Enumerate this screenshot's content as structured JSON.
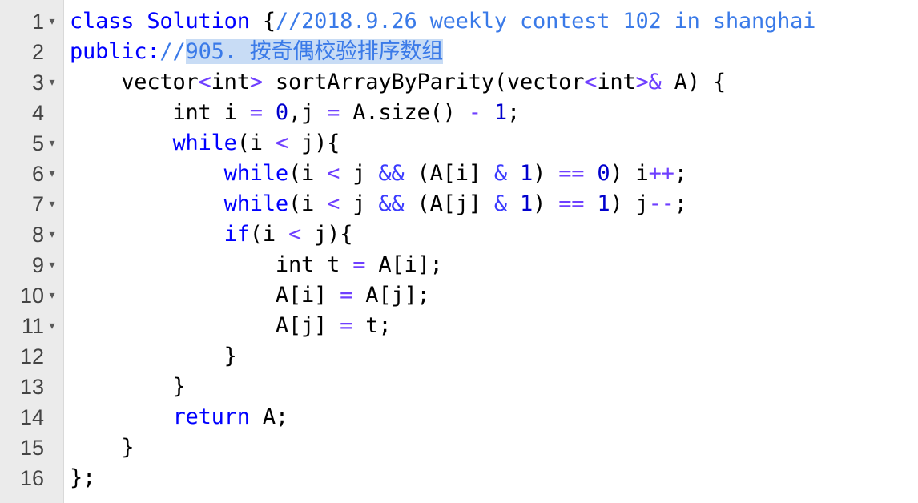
{
  "editor": {
    "lines": [
      {
        "num": "1",
        "fold": "▾",
        "tokens": [
          {
            "t": "class Solution ",
            "c": "kw"
          },
          {
            "t": "{",
            "c": "plain"
          },
          {
            "t": "//2018.9.26 weekly contest 102 in shanghai",
            "c": "cm"
          }
        ]
      },
      {
        "num": "2",
        "fold": "",
        "tokens": [
          {
            "t": "public:",
            "c": "kw"
          },
          {
            "t": "//",
            "c": "cm"
          },
          {
            "t": "905. 按奇偶校验排序数组",
            "c": "cm sel"
          }
        ]
      },
      {
        "num": "3",
        "fold": "▾",
        "tokens": [
          {
            "t": "    vector",
            "c": "plain"
          },
          {
            "t": "<",
            "c": "op"
          },
          {
            "t": "int",
            "c": "plain"
          },
          {
            "t": ">",
            "c": "op"
          },
          {
            "t": " sortArrayByParity(vector",
            "c": "plain"
          },
          {
            "t": "<",
            "c": "op"
          },
          {
            "t": "int",
            "c": "plain"
          },
          {
            "t": ">&",
            "c": "op"
          },
          {
            "t": " A) {",
            "c": "plain"
          }
        ]
      },
      {
        "num": "4",
        "fold": "",
        "tokens": [
          {
            "t": "        int i ",
            "c": "plain"
          },
          {
            "t": "=",
            "c": "op"
          },
          {
            "t": " ",
            "c": "plain"
          },
          {
            "t": "0",
            "c": "num"
          },
          {
            "t": ",j ",
            "c": "plain"
          },
          {
            "t": "=",
            "c": "op"
          },
          {
            "t": " A.size() ",
            "c": "plain"
          },
          {
            "t": "-",
            "c": "op"
          },
          {
            "t": " ",
            "c": "plain"
          },
          {
            "t": "1",
            "c": "num"
          },
          {
            "t": ";",
            "c": "plain"
          }
        ]
      },
      {
        "num": "5",
        "fold": "▾",
        "tokens": [
          {
            "t": "        ",
            "c": "plain"
          },
          {
            "t": "while",
            "c": "kw"
          },
          {
            "t": "(i ",
            "c": "plain"
          },
          {
            "t": "<",
            "c": "op"
          },
          {
            "t": " j){",
            "c": "plain"
          }
        ]
      },
      {
        "num": "6",
        "fold": "▾",
        "tokens": [
          {
            "t": "            ",
            "c": "plain"
          },
          {
            "t": "while",
            "c": "kw"
          },
          {
            "t": "(i ",
            "c": "plain"
          },
          {
            "t": "<",
            "c": "op"
          },
          {
            "t": " j ",
            "c": "plain"
          },
          {
            "t": "&&",
            "c": "op2"
          },
          {
            "t": " (A[i] ",
            "c": "plain"
          },
          {
            "t": "&",
            "c": "op2"
          },
          {
            "t": " ",
            "c": "plain"
          },
          {
            "t": "1",
            "c": "num"
          },
          {
            "t": ") ",
            "c": "plain"
          },
          {
            "t": "==",
            "c": "op"
          },
          {
            "t": " ",
            "c": "plain"
          },
          {
            "t": "0",
            "c": "num"
          },
          {
            "t": ") i",
            "c": "plain"
          },
          {
            "t": "++",
            "c": "op"
          },
          {
            "t": ";",
            "c": "plain"
          }
        ]
      },
      {
        "num": "7",
        "fold": "▾",
        "tokens": [
          {
            "t": "            ",
            "c": "plain"
          },
          {
            "t": "while",
            "c": "kw"
          },
          {
            "t": "(i ",
            "c": "plain"
          },
          {
            "t": "<",
            "c": "op"
          },
          {
            "t": " j ",
            "c": "plain"
          },
          {
            "t": "&&",
            "c": "op2"
          },
          {
            "t": " (A[j] ",
            "c": "plain"
          },
          {
            "t": "&",
            "c": "op2"
          },
          {
            "t": " ",
            "c": "plain"
          },
          {
            "t": "1",
            "c": "num"
          },
          {
            "t": ") ",
            "c": "plain"
          },
          {
            "t": "==",
            "c": "op"
          },
          {
            "t": " ",
            "c": "plain"
          },
          {
            "t": "1",
            "c": "num"
          },
          {
            "t": ") j",
            "c": "plain"
          },
          {
            "t": "--",
            "c": "op"
          },
          {
            "t": ";",
            "c": "plain"
          }
        ]
      },
      {
        "num": "8",
        "fold": "▾",
        "tokens": [
          {
            "t": "            ",
            "c": "plain"
          },
          {
            "t": "if",
            "c": "kw"
          },
          {
            "t": "(i ",
            "c": "plain"
          },
          {
            "t": "<",
            "c": "op"
          },
          {
            "t": " j){",
            "c": "plain"
          }
        ]
      },
      {
        "num": "9",
        "fold": "▾",
        "tokens": [
          {
            "t": "                int t ",
            "c": "plain"
          },
          {
            "t": "=",
            "c": "op"
          },
          {
            "t": " A[i];",
            "c": "plain"
          }
        ]
      },
      {
        "num": "10",
        "fold": "▾",
        "tokens": [
          {
            "t": "                A[i] ",
            "c": "plain"
          },
          {
            "t": "=",
            "c": "op"
          },
          {
            "t": " A[j];",
            "c": "plain"
          }
        ]
      },
      {
        "num": "11",
        "fold": "▾",
        "tokens": [
          {
            "t": "                A[j] ",
            "c": "plain"
          },
          {
            "t": "=",
            "c": "op"
          },
          {
            "t": " t;",
            "c": "plain"
          }
        ]
      },
      {
        "num": "12",
        "fold": "",
        "tokens": [
          {
            "t": "            }",
            "c": "plain"
          }
        ]
      },
      {
        "num": "13",
        "fold": "",
        "tokens": [
          {
            "t": "        }",
            "c": "plain"
          }
        ]
      },
      {
        "num": "14",
        "fold": "",
        "tokens": [
          {
            "t": "        ",
            "c": "plain"
          },
          {
            "t": "return",
            "c": "kw"
          },
          {
            "t": " A;",
            "c": "plain"
          }
        ]
      },
      {
        "num": "15",
        "fold": "",
        "tokens": [
          {
            "t": "    }",
            "c": "plain"
          }
        ]
      },
      {
        "num": "16",
        "fold": "",
        "tokens": [
          {
            "t": "};",
            "c": "plain"
          }
        ]
      }
    ]
  }
}
